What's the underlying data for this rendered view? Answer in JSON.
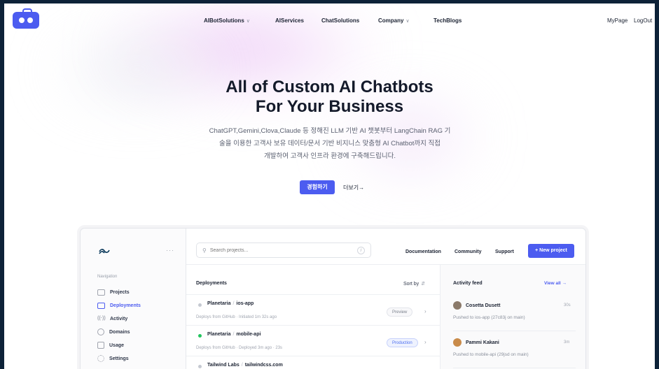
{
  "nav": {
    "items": [
      {
        "label": "AIBotSolutions",
        "dropdown": true
      },
      {
        "label": "AIServices",
        "dropdown": false
      },
      {
        "label": "ChatSolutions",
        "dropdown": false
      },
      {
        "label": "Company",
        "dropdown": true
      },
      {
        "label": "TechBlogs",
        "dropdown": false
      }
    ],
    "mypage": "MyPage",
    "logout": "LogOut",
    "chevron": "∨"
  },
  "hero": {
    "title_line1": "All of Custom AI Chatbots",
    "title_line2": "For Your Business",
    "desc_line1": "ChatGPT,Gemini,Clova,Claude 등 정해진 LLM 기반 AI 챗봇부터 LangChain RAG 기",
    "desc_line2": "술을 이용한 고객사 보유 데이터/문서 기반 비지니스 맞춤형 AI Chatbot까지 직접",
    "desc_line3": "개발하여 고객사 인프라 환경에 구축해드립니다.",
    "cta": "경험하기",
    "more": "더보기→"
  },
  "mock": {
    "sidebar": {
      "heading": "Navigation",
      "items": [
        {
          "label": "Projects",
          "icon": "folder-icon",
          "active": false
        },
        {
          "label": "Deployments",
          "icon": "server-icon",
          "active": true
        },
        {
          "label": "Activity",
          "icon": "signal-icon",
          "active": false
        },
        {
          "label": "Domains",
          "icon": "globe-icon",
          "active": false
        },
        {
          "label": "Usage",
          "icon": "chart-icon",
          "active": false
        },
        {
          "label": "Settings",
          "icon": "gear-icon",
          "active": false
        }
      ],
      "more": "···"
    },
    "topbar": {
      "search_placeholder": "Search projects...",
      "kbd": "/",
      "links": [
        "Documentation",
        "Community",
        "Support"
      ],
      "new_project": "+ New project"
    },
    "deployments": {
      "heading": "Deployments",
      "sort": "Sort by",
      "rows": [
        {
          "org": "Planetaria",
          "repo": "ios-app",
          "meta": "Deploys from GitHub  ·  Initiated 1m 32s ago",
          "badge": "Preview",
          "status": "gray"
        },
        {
          "org": "Planetaria",
          "repo": "mobile-api",
          "meta": "Deploys from GitHub  ·  Deployed 3m ago  ·  23s",
          "badge": "Production",
          "status": "green"
        },
        {
          "org": "Tailwind Labs",
          "repo": "tailwindcss.com",
          "meta": "",
          "badge": "",
          "status": "gray"
        }
      ]
    },
    "feed": {
      "heading": "Activity feed",
      "view_all": "View all →",
      "entries": [
        {
          "name": "Cosetta Dusett",
          "time": "30s",
          "text": "Pushed to ios-app (27c83j on main)",
          "avatar_color": "#8b7a6a"
        },
        {
          "name": "Pammi Kakani",
          "time": "3m",
          "text": "Pushed to mobile-api (29jsd on main)",
          "avatar_color": "#c98b4a"
        }
      ]
    }
  }
}
